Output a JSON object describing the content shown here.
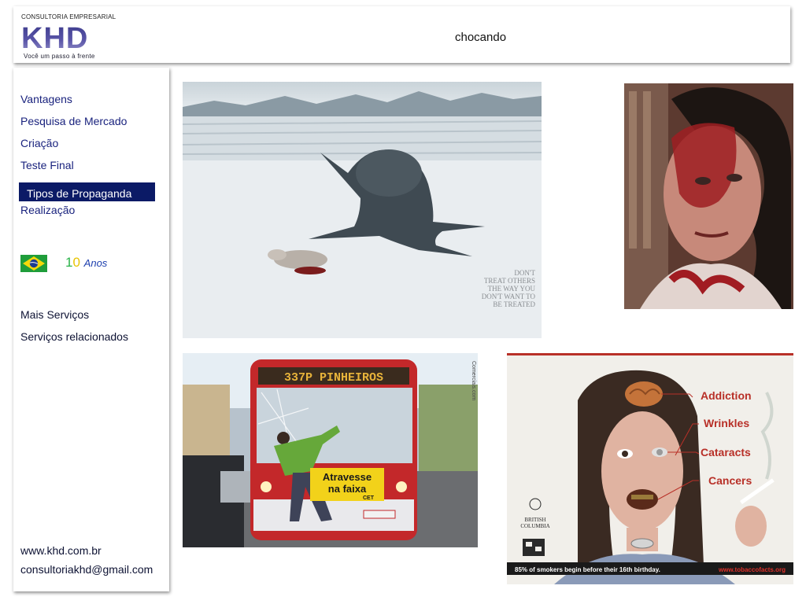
{
  "header": {
    "logo": {
      "top_text": "CONSULTORIA EMPRESARIAL",
      "mark": "KHD",
      "tagline": "Você um passo à frente"
    },
    "title": "chocando"
  },
  "sidebar": {
    "items": [
      {
        "label": "Vantagens"
      },
      {
        "label": "Pesquisa de Mercado"
      },
      {
        "label": "Criação"
      },
      {
        "label": "Teste Final"
      },
      {
        "label": "Tipos de Propaganda",
        "active": true
      },
      {
        "label": "Realização"
      }
    ],
    "badge": {
      "digit1": "1",
      "digit2": "0",
      "word": "Anos"
    },
    "extra_items": [
      {
        "label": "Mais Serviços"
      },
      {
        "label": "Serviços relacionados"
      }
    ],
    "footer": {
      "website": "www.khd.com.br",
      "email": "consultoriakhd@gmail.com"
    }
  },
  "ads": {
    "seal": {
      "caption": "DON'T TREAT OTHERS THE WAY YOU DON'T WANT TO BE TREATED"
    },
    "bus": {
      "destination": "337P PINHEIROS",
      "banner_line1": "Atravesse",
      "banner_line2": "na faixa",
      "banner_brand": "CET",
      "side_text": "Comerciais.com"
    },
    "smoker": {
      "labels": [
        "Addiction",
        "Wrinkles",
        "Cataracts",
        "Cancers"
      ],
      "logo_text": "BRITISH COLUMBIA",
      "footer_left": "85% of smokers begin before their 16th birthday.",
      "footer_right": "www.tobaccofacts.org"
    }
  },
  "colors": {
    "accent": "#0b1a66",
    "link": "#1a237e"
  }
}
